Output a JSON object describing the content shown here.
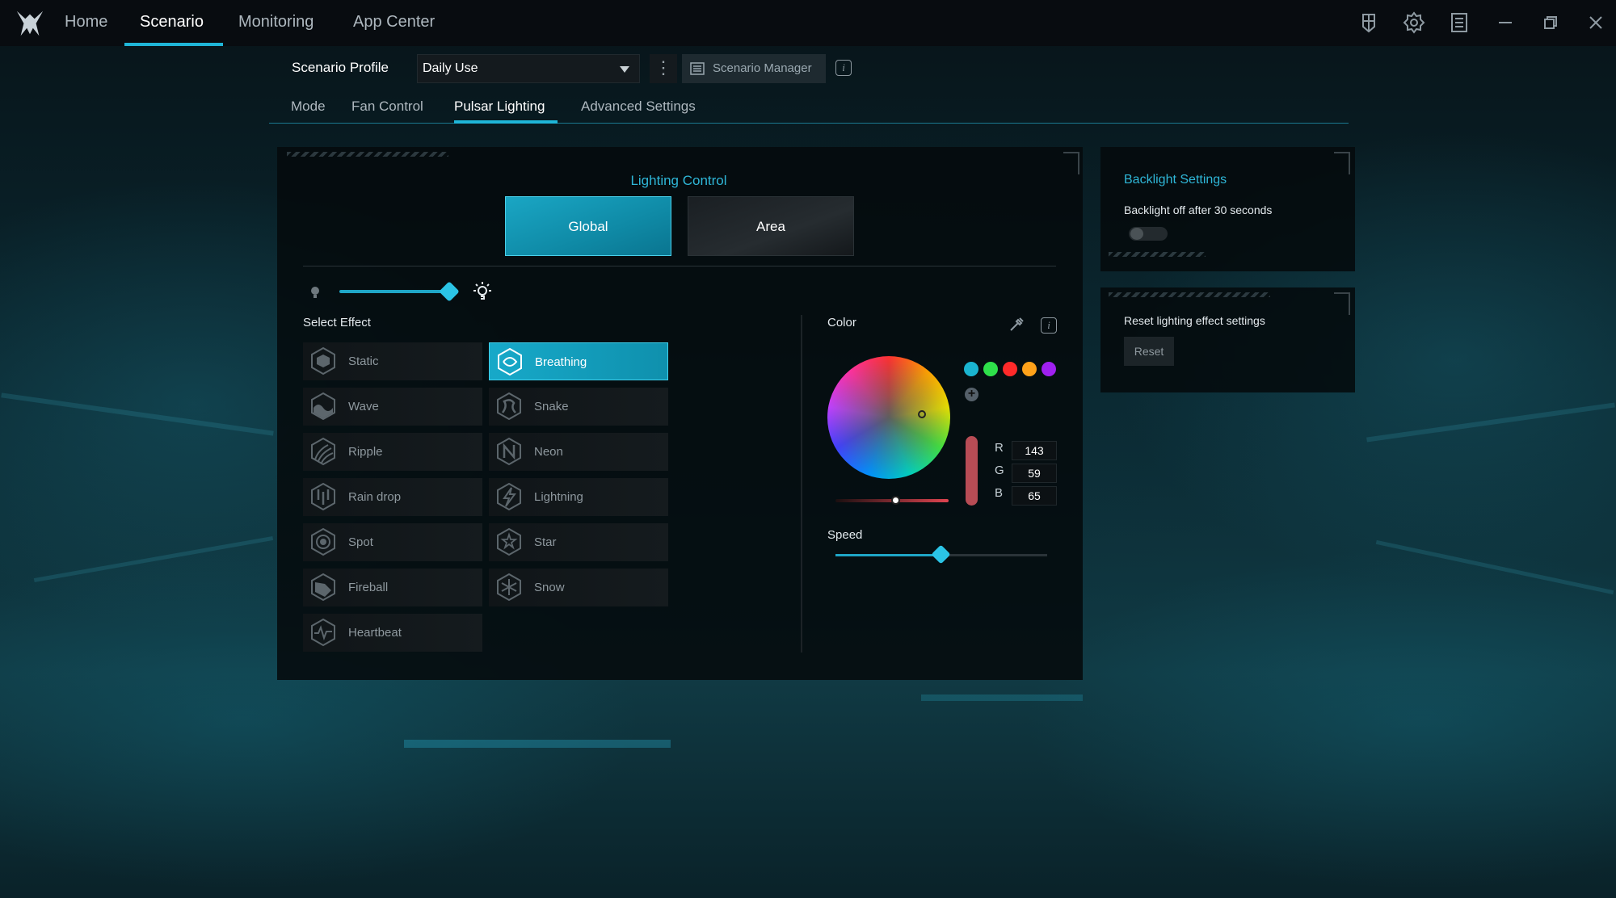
{
  "nav": {
    "home": "Home",
    "scenario": "Scenario",
    "monitoring": "Monitoring",
    "app_center": "App Center"
  },
  "profile": {
    "label": "Scenario Profile",
    "selected": "Daily Use",
    "manager": "Scenario Manager"
  },
  "subtabs": {
    "mode": "Mode",
    "fan": "Fan Control",
    "pulsar": "Pulsar Lighting",
    "advanced": "Advanced Settings"
  },
  "lighting": {
    "title": "Lighting Control",
    "global": "Global",
    "area": "Area",
    "brightness_percent": 88,
    "select_effect": "Select Effect",
    "effects_left": [
      "Static",
      "Wave",
      "Ripple",
      "Rain drop",
      "Spot",
      "Fireball",
      "Heartbeat"
    ],
    "effects_right": [
      "Breathing",
      "Snake",
      "Neon",
      "Lightning",
      "Star",
      "Snow"
    ],
    "selected_effect": "Breathing"
  },
  "color": {
    "label": "Color",
    "swatches": [
      "#1ab4d0",
      "#2ee04a",
      "#ff2a2a",
      "#ffa21a",
      "#a020f0"
    ],
    "r_label": "R",
    "g_label": "G",
    "b_label": "B",
    "r": "143",
    "g": "59",
    "b": "65",
    "preview": "#b84c55"
  },
  "speed": {
    "label": "Speed",
    "percent": 50
  },
  "backlight": {
    "title": "Backlight Settings",
    "text": "Backlight off after 30 seconds",
    "enabled": false
  },
  "reset": {
    "text": "Reset lighting effect settings",
    "button": "Reset"
  },
  "colors": {
    "accent": "#1fb6d8"
  }
}
